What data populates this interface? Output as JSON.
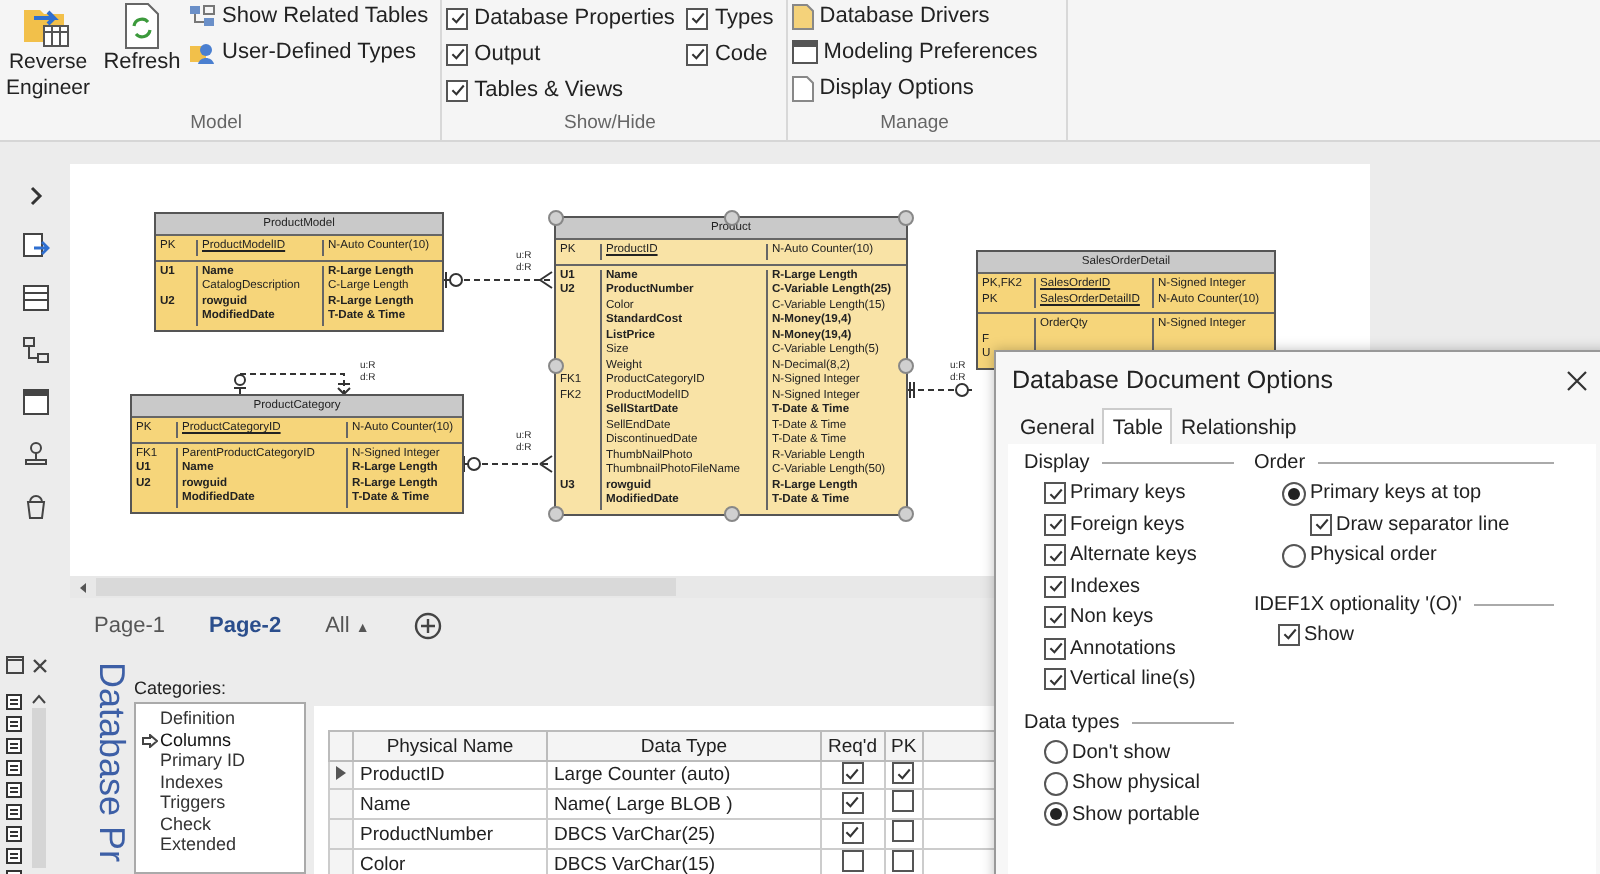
{
  "ribbon": {
    "model": {
      "title": "Model",
      "large_buttons": [
        "Reverse Engineer",
        "Refresh"
      ],
      "items": [
        "Show Related Tables",
        "User-Defined Types"
      ]
    },
    "show_hide": {
      "title": "Show/Hide",
      "options": [
        {
          "label": "Database Properties",
          "checked": true
        },
        {
          "label": "Types",
          "checked": true
        },
        {
          "label": "Output",
          "checked": true
        },
        {
          "label": "Code",
          "checked": true
        },
        {
          "label": "Tables & Views",
          "checked": true
        }
      ]
    },
    "manage": {
      "title": "Manage",
      "items": [
        "Database Drivers",
        "Modeling Preferences",
        "Display Options"
      ]
    }
  },
  "diagram": {
    "entities": [
      {
        "name": "ProductModel",
        "selected": false,
        "key_attributes": [
          {
            "key": "PK",
            "name": "ProductModelID",
            "type": "N-Auto Counter(10)",
            "mandatory": false
          }
        ],
        "attributes": [
          {
            "key": "U1",
            "name": "Name",
            "type": "R-Large Length",
            "mandatory": true
          },
          {
            "name": "CatalogDescription",
            "type": "C-Large Length",
            "mandatory": false
          },
          {
            "key": "U2",
            "name": "rowguid",
            "type": "R-Large Length",
            "mandatory": true
          },
          {
            "name": "ModifiedDate",
            "type": "T-Date & Time",
            "mandatory": true
          }
        ]
      },
      {
        "name": "ProductCategory",
        "selected": false,
        "key_attributes": [
          {
            "key": "PK",
            "name": "ProductCategoryID",
            "type": "N-Auto Counter(10)",
            "mandatory": false
          }
        ],
        "attributes": [
          {
            "key": "FK1",
            "name": "ParentProductCategoryID",
            "type": "N-Signed Integer",
            "mandatory": false
          },
          {
            "key": "U1",
            "name": "Name",
            "type": "R-Large Length",
            "mandatory": true
          },
          {
            "key": "U2",
            "name": "rowguid",
            "type": "R-Large Length",
            "mandatory": true
          },
          {
            "name": "ModifiedDate",
            "type": "T-Date & Time",
            "mandatory": true
          }
        ]
      },
      {
        "name": "Product",
        "selected": true,
        "key_attributes": [
          {
            "key": "PK",
            "name": "ProductID",
            "type": "N-Auto Counter(10)",
            "mandatory": false
          }
        ],
        "attributes": [
          {
            "key": "U1",
            "name": "Name",
            "type": "R-Large Length",
            "mandatory": true
          },
          {
            "key": "U2",
            "name": "ProductNumber",
            "type": "C-Variable Length(25)",
            "mandatory": true
          },
          {
            "name": "Color",
            "type": "C-Variable Length(15)",
            "mandatory": false
          },
          {
            "name": "StandardCost",
            "type": "N-Money(19,4)",
            "mandatory": true
          },
          {
            "name": "ListPrice",
            "type": "N-Money(19,4)",
            "mandatory": true
          },
          {
            "name": "Size",
            "type": "C-Variable Length(5)",
            "mandatory": false
          },
          {
            "name": "Weight",
            "type": "N-Decimal(8,2)",
            "mandatory": false
          },
          {
            "key": "FK1",
            "name": "ProductCategoryID",
            "type": "N-Signed Integer",
            "mandatory": false
          },
          {
            "key": "FK2",
            "name": "ProductModelID",
            "type": "N-Signed Integer",
            "mandatory": false
          },
          {
            "name": "SellStartDate",
            "type": "T-Date & Time",
            "mandatory": true
          },
          {
            "name": "SellEndDate",
            "type": "T-Date & Time",
            "mandatory": false
          },
          {
            "name": "DiscontinuedDate",
            "type": "T-Date & Time",
            "mandatory": false
          },
          {
            "name": "ThumbNailPhoto",
            "type": "R-Variable Length",
            "mandatory": false
          },
          {
            "name": "ThumbnailPhotoFileName",
            "type": "C-Variable Length(50)",
            "mandatory": false
          },
          {
            "key": "U3",
            "name": "rowguid",
            "type": "R-Large Length",
            "mandatory": true
          },
          {
            "name": "ModifiedDate",
            "type": "T-Date & Time",
            "mandatory": true
          }
        ]
      },
      {
        "name": "SalesOrderDetail",
        "selected": false,
        "key_attributes": [
          {
            "key": "PK,FK2",
            "name": "SalesOrderID",
            "type": "N-Signed Integer",
            "mandatory": false
          },
          {
            "key": "PK",
            "name": "SalesOrderDetailID",
            "type": "N-Auto Counter(10)",
            "mandatory": false
          }
        ],
        "attributes": [
          {
            "name": "OrderQty",
            "type": "N-Signed Integer",
            "mandatory": false
          },
          {
            "key": "F"
          },
          {
            "key": "U"
          }
        ]
      }
    ],
    "relationships": [
      {
        "labels": [
          "u:R",
          "d:R"
        ]
      },
      {
        "labels": [
          "u:R",
          "d:R"
        ]
      },
      {
        "labels": [
          "u:R",
          "d:R"
        ]
      },
      {
        "labels": [
          "u:R",
          "d:R"
        ]
      }
    ]
  },
  "page_tabs": [
    {
      "label": "Page-1",
      "selected": false
    },
    {
      "label": "Page-2",
      "selected": true
    }
  ],
  "all_pages_menu": {
    "label": "All",
    "arrow": "▲"
  },
  "properties": {
    "title": "Database Pr",
    "categories_label": "Categories:",
    "categories": [
      {
        "label": "Definition",
        "selected": false
      },
      {
        "label": "Columns",
        "selected": true
      },
      {
        "label": "Primary ID",
        "selected": false
      },
      {
        "label": "Indexes",
        "selected": false
      },
      {
        "label": "Triggers",
        "selected": false
      },
      {
        "label": "Check",
        "selected": false
      },
      {
        "label": "Extended",
        "selected": false
      }
    ],
    "table": {
      "columns": [
        "Physical Name",
        "Data Type",
        "Req'd",
        "PK"
      ],
      "rows": [
        {
          "name": "ProductID",
          "type": "Large Counter (auto)",
          "required": true,
          "pk": true,
          "current": true
        },
        {
          "name": "Name",
          "type": "Name( Large BLOB )",
          "required": true,
          "pk": false,
          "current": false
        },
        {
          "name": "ProductNumber",
          "type": "DBCS VarChar(25)",
          "required": true,
          "pk": false,
          "current": false
        },
        {
          "name": "Color",
          "type": "DBCS VarChar(15)",
          "required": false,
          "pk": false,
          "current": false
        }
      ]
    }
  },
  "dialog": {
    "title": "Database Document Options",
    "tabs": [
      {
        "label": "General",
        "selected": false
      },
      {
        "label": "Table",
        "selected": true
      },
      {
        "label": "Relationship",
        "selected": false
      }
    ],
    "display": {
      "label": "Display",
      "options": [
        {
          "label": "Primary keys",
          "checked": true
        },
        {
          "label": "Foreign keys",
          "checked": true
        },
        {
          "label": "Alternate keys",
          "checked": true
        },
        {
          "label": "Indexes",
          "checked": true
        },
        {
          "label": "Non keys",
          "checked": true
        },
        {
          "label": "Annotations",
          "checked": true
        },
        {
          "label": "Vertical line(s)",
          "checked": true
        }
      ]
    },
    "data_types": {
      "label": "Data types",
      "options": [
        {
          "label": "Don't show",
          "selected": false
        },
        {
          "label": "Show physical",
          "selected": false
        },
        {
          "label": "Show portable",
          "selected": true
        }
      ]
    },
    "order": {
      "label": "Order",
      "primary_keys_at_top": {
        "label": "Primary keys at top",
        "selected": true
      },
      "draw_separator_line": {
        "label": "Draw separator line",
        "checked": true
      },
      "physical_order": {
        "label": "Physical order",
        "selected": false
      }
    },
    "optionality": {
      "label": "IDEF1X optionality '(O)'",
      "show": {
        "label": "Show",
        "checked": true
      }
    }
  }
}
